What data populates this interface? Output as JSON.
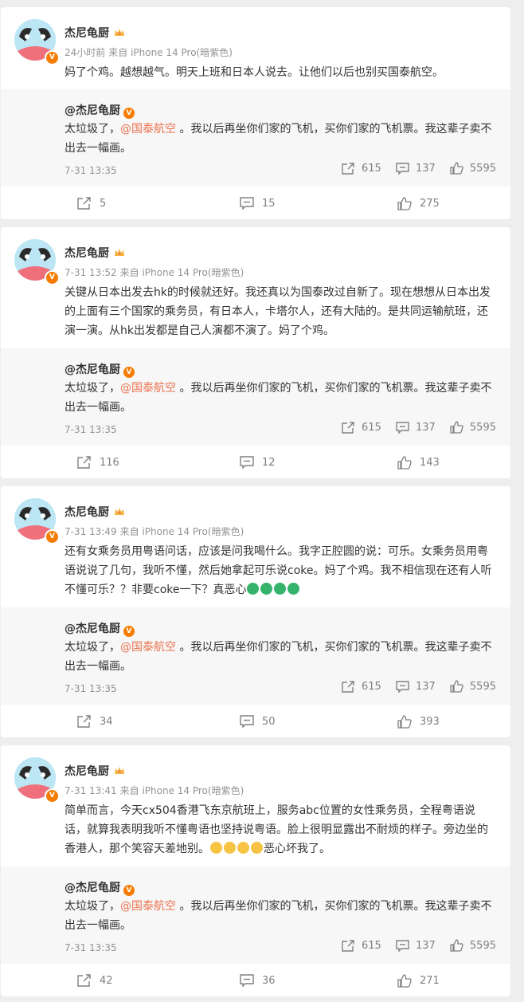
{
  "posts": [
    {
      "author": "杰尼龟厨",
      "time": "24小时前",
      "source": "来自 iPhone 14 Pro(暗紫色)",
      "text": "妈了个鸡。越想越气。明天上班和日本人说去。让他们以后也别买国泰航空。",
      "forward_count": "5",
      "comment_count": "15",
      "like_count": "275"
    },
    {
      "author": "杰尼龟厨",
      "time": "7-31 13:52",
      "source": "来自 iPhone 14 Pro(暗紫色)",
      "text": "关键从日本出发去hk的时候就还好。我还真以为国泰改过自新了。现在想想从日本出发的上面有三个国家的乘务员，有日本人，卡塔尔人，还有大陆的。是共同运输航班，还演一演。从hk出发都是自己人演都不演了。妈了个鸡。",
      "forward_count": "116",
      "comment_count": "12",
      "like_count": "143"
    },
    {
      "author": "杰尼龟厨",
      "time": "7-31 13:49",
      "source": "来自 iPhone 14 Pro(暗紫色)",
      "text": "还有女乘务员用粤语问话，应该是问我喝什么。我字正腔圆的说：可乐。女乘务员用粤语说说了几句，我听不懂，然后她拿起可乐说coke。妈了个鸡。我不相信现在还有人听不懂可乐？？非要coke一下？真恶心",
      "forward_count": "34",
      "comment_count": "50",
      "like_count": "393"
    },
    {
      "author": "杰尼龟厨",
      "time": "7-31 13:41",
      "source": "来自 iPhone 14 Pro(暗紫色)",
      "text": "简单而言，今天cx504香港飞东京航班上，服务abc位置的女性乘务员，全程粤语说话，就算我表明我听不懂粤语也坚持说粤语。脸上很明显露出不耐烦的样子。旁边坐的香港人，那个笑容天差地别。",
      "text_tail": "恶心坏我了。",
      "forward_count": "42",
      "comment_count": "36",
      "like_count": "271"
    }
  ],
  "repost": {
    "author": "@杰尼龟厨",
    "text_pre": "太垃圾了，",
    "mention": "@国泰航空",
    "text_post": " 。我以后再坐你们家的飞机，买你们家的飞机票。我这辈子卖不出去一幅画。",
    "time": "7-31 13:35",
    "forward_count": "615",
    "comment_count": "137",
    "like_count": "5595"
  },
  "colors": {
    "mention": "#eb7350",
    "accent_v": "#f57c00",
    "meta": "#939393"
  }
}
